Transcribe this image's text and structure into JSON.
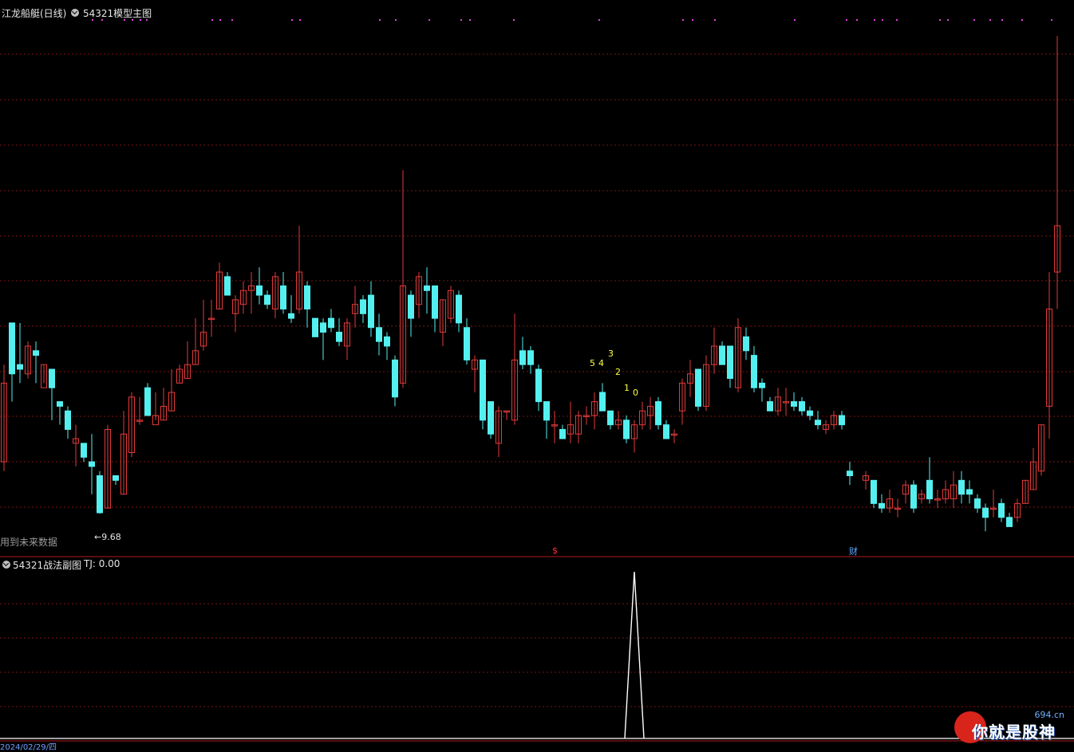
{
  "header": {
    "title": "江龙船艇(日线)",
    "model_name": "54321模型主图"
  },
  "sub_header": {
    "title": "54321战法副图",
    "tj_label": "TJ: 0.00"
  },
  "annotations": {
    "future_data": "用到未来数据",
    "low_label": "←9.68",
    "signal_s": "$",
    "signal_cai": "财",
    "countdown": [
      "5",
      "4",
      "3",
      "2",
      "1",
      "0"
    ],
    "date_label": "2024/02/29/四"
  },
  "watermark": {
    "site": "694.cn",
    "text": "你就是股神"
  },
  "colors": {
    "up": "#e23a3a",
    "down": "#54f0f0",
    "grid": "#7a1414",
    "signal_dot": "#e040e0",
    "countdown": "#ffff44",
    "tj_line": "#ffffff"
  },
  "chart_data": [
    {
      "type": "candlestick",
      "ylim": [
        9.2,
        20.0
      ],
      "series": [
        {
          "values": [
            [
              10.8,
              12.5,
              12.9,
              10.6
            ],
            [
              13.8,
              12.7,
              13.5,
              12.1
            ],
            [
              12.9,
              12.8,
              13.8,
              12.5
            ],
            [
              12.7,
              13.3,
              13.4,
              12.6
            ],
            [
              13.2,
              13.1,
              13.4,
              12.5
            ],
            [
              12.4,
              12.9,
              12.9,
              12.5
            ],
            [
              12.8,
              12.4,
              12.8,
              11.7
            ],
            [
              12.1,
              12.0,
              12.1,
              11.6
            ],
            [
              11.9,
              11.5,
              12.0,
              11.3
            ],
            [
              11.2,
              11.3,
              11.6,
              10.7
            ],
            [
              11.2,
              10.9,
              11.2,
              10.8
            ],
            [
              10.8,
              10.7,
              11.4,
              10.1
            ],
            [
              10.5,
              9.7,
              10.6,
              9.68
            ],
            [
              9.8,
              11.5,
              11.6,
              9.8
            ],
            [
              10.5,
              10.4,
              10.5,
              10.3
            ],
            [
              10.1,
              11.4,
              11.9,
              10.1
            ],
            [
              11.0,
              12.2,
              12.3,
              10.9
            ],
            [
              11.7,
              11.7,
              12.2,
              11.6
            ],
            [
              12.4,
              11.8,
              12.5,
              11.8
            ],
            [
              11.6,
              11.8,
              12.3,
              11.7
            ],
            [
              11.7,
              12.0,
              12.4,
              11.7
            ],
            [
              11.9,
              12.3,
              12.8,
              11.9
            ],
            [
              12.5,
              12.8,
              12.9,
              12.5
            ],
            [
              12.6,
              12.9,
              13.4,
              12.6
            ],
            [
              12.9,
              13.2,
              13.9,
              12.9
            ],
            [
              13.3,
              13.6,
              14.3,
              13.2
            ],
            [
              13.9,
              13.9,
              14.3,
              13.5
            ],
            [
              14.1,
              14.9,
              15.1,
              14.1
            ],
            [
              14.8,
              14.4,
              14.9,
              14.4
            ],
            [
              14.0,
              14.3,
              14.4,
              13.6
            ],
            [
              14.2,
              14.5,
              14.7,
              14.0
            ],
            [
              14.5,
              14.6,
              14.9,
              14.0
            ],
            [
              14.6,
              14.4,
              15.0,
              14.2
            ],
            [
              14.4,
              14.2,
              14.5,
              14.1
            ],
            [
              14.1,
              14.8,
              14.9,
              13.9
            ],
            [
              14.6,
              14.1,
              14.9,
              14.0
            ],
            [
              14.0,
              13.9,
              14.4,
              13.8
            ],
            [
              14.1,
              14.9,
              15.9,
              14.0
            ],
            [
              14.6,
              14.1,
              14.7,
              13.7
            ],
            [
              13.9,
              13.5,
              13.9,
              13.5
            ],
            [
              13.8,
              13.6,
              13.9,
              13.0
            ],
            [
              13.9,
              13.7,
              14.1,
              13.6
            ],
            [
              13.6,
              13.4,
              13.9,
              13.3
            ],
            [
              13.3,
              13.8,
              13.9,
              13.0
            ],
            [
              14.0,
              14.2,
              14.6,
              13.7
            ],
            [
              14.3,
              14.0,
              14.4,
              13.8
            ],
            [
              14.4,
              13.7,
              14.7,
              13.5
            ],
            [
              13.7,
              13.4,
              14.0,
              13.1
            ],
            [
              13.5,
              13.3,
              13.6,
              13.0
            ],
            [
              13.0,
              12.2,
              13.1,
              12.0
            ],
            [
              12.5,
              14.6,
              17.1,
              12.4
            ],
            [
              14.4,
              13.9,
              14.5,
              13.5
            ],
            [
              14.2,
              14.8,
              14.9,
              13.9
            ],
            [
              14.6,
              14.5,
              15.0,
              14.0
            ],
            [
              14.6,
              13.9,
              14.5,
              13.6
            ],
            [
              13.6,
              14.3,
              14.3,
              13.3
            ],
            [
              13.9,
              14.5,
              14.6,
              13.8
            ],
            [
              14.4,
              13.8,
              14.5,
              13.6
            ],
            [
              13.7,
              13.0,
              13.9,
              12.9
            ],
            [
              12.8,
              13.0,
              13.1,
              12.3
            ],
            [
              13.0,
              11.7,
              13.0,
              11.5
            ],
            [
              12.1,
              11.4,
              12.1,
              11.3
            ],
            [
              11.2,
              11.9,
              12.0,
              10.9
            ],
            [
              11.9,
              11.9,
              11.9,
              11.7
            ],
            [
              11.7,
              13.0,
              14.0,
              11.6
            ],
            [
              13.2,
              12.9,
              13.5,
              12.8
            ],
            [
              13.2,
              12.9,
              13.3,
              12.7
            ],
            [
              12.8,
              12.1,
              12.9,
              11.9
            ],
            [
              12.1,
              11.7,
              12.1,
              11.3
            ],
            [
              11.6,
              11.6,
              11.9,
              11.2
            ],
            [
              11.5,
              11.3,
              11.6,
              11.3
            ],
            [
              11.4,
              11.6,
              12.1,
              11.2
            ],
            [
              11.4,
              11.8,
              11.9,
              11.2
            ],
            [
              11.8,
              11.8,
              12.0,
              11.6
            ],
            [
              11.8,
              12.1,
              12.3,
              11.5
            ],
            [
              12.3,
              11.9,
              12.5,
              11.9
            ],
            [
              11.9,
              11.6,
              11.9,
              11.5
            ],
            [
              11.6,
              11.7,
              11.9,
              11.5
            ],
            [
              11.7,
              11.3,
              11.8,
              11.2
            ],
            [
              11.3,
              11.6,
              11.7,
              11.0
            ],
            [
              11.6,
              11.9,
              12.1,
              11.5
            ],
            [
              11.8,
              12.0,
              12.2,
              11.5
            ],
            [
              12.1,
              11.6,
              12.2,
              11.5
            ],
            [
              11.6,
              11.3,
              11.7,
              11.3
            ],
            [
              11.4,
              11.4,
              11.5,
              11.2
            ],
            [
              11.9,
              12.5,
              12.6,
              11.6
            ],
            [
              12.5,
              12.7,
              13.0,
              12.2
            ],
            [
              12.8,
              12.0,
              12.8,
              11.9
            ],
            [
              12.0,
              12.9,
              13.1,
              11.9
            ],
            [
              12.9,
              13.3,
              13.7,
              12.7
            ],
            [
              13.3,
              12.9,
              13.4,
              12.9
            ],
            [
              13.3,
              12.6,
              13.3,
              12.4
            ],
            [
              12.4,
              13.7,
              13.9,
              12.3
            ],
            [
              13.5,
              13.2,
              13.7,
              13.0
            ],
            [
              13.1,
              12.4,
              13.3,
              12.3
            ],
            [
              12.5,
              12.4,
              12.6,
              12.1
            ],
            [
              12.1,
              11.9,
              12.2,
              11.9
            ],
            [
              11.9,
              12.2,
              12.4,
              11.8
            ],
            [
              12.1,
              12.1,
              12.4,
              11.8
            ],
            [
              12.1,
              12.0,
              12.3,
              11.9
            ],
            [
              12.1,
              11.9,
              12.2,
              11.8
            ],
            [
              11.9,
              11.8,
              12.0,
              11.7
            ],
            [
              11.7,
              11.6,
              11.9,
              11.5
            ],
            [
              11.5,
              11.6,
              11.7,
              11.4
            ],
            [
              11.6,
              11.8,
              11.9,
              11.5
            ],
            [
              11.8,
              11.6,
              11.9,
              11.5
            ],
            [
              10.6,
              10.5,
              10.8,
              10.3
            ],
            [
              10.4,
              10.5,
              10.6,
              10.2
            ],
            [
              10.4,
              9.9,
              10.4,
              9.8
            ],
            [
              9.9,
              9.8,
              10.1,
              9.7
            ],
            [
              9.8,
              10.0,
              10.2,
              9.7
            ],
            [
              9.8,
              9.8,
              10.0,
              9.6
            ],
            [
              10.1,
              10.3,
              10.4,
              9.9
            ],
            [
              10.3,
              9.8,
              10.4,
              9.7
            ],
            [
              10.0,
              10.1,
              10.2,
              9.9
            ],
            [
              10.4,
              10.0,
              10.9,
              9.9
            ],
            [
              10.0,
              10.0,
              10.2,
              9.8
            ],
            [
              10.0,
              10.2,
              10.4,
              9.9
            ],
            [
              10.0,
              10.3,
              10.6,
              9.8
            ],
            [
              10.4,
              10.1,
              10.6,
              9.9
            ],
            [
              10.2,
              10.1,
              10.4,
              9.9
            ],
            [
              10.0,
              9.8,
              10.1,
              9.7
            ],
            [
              9.8,
              9.6,
              9.9,
              9.3
            ],
            [
              9.8,
              9.8,
              10.2,
              9.6
            ],
            [
              9.9,
              9.6,
              10.0,
              9.5
            ],
            [
              9.6,
              9.4,
              9.7,
              9.4
            ],
            [
              9.6,
              9.9,
              10.0,
              9.5
            ],
            [
              9.9,
              10.4,
              10.4,
              9.9
            ],
            [
              10.2,
              10.8,
              11.1,
              10.2
            ],
            [
              10.6,
              11.6,
              11.6,
              10.5
            ],
            [
              12.0,
              14.1,
              14.9,
              11.3
            ],
            [
              14.9,
              15.9,
              20.0,
              14.1
            ]
          ]
        }
      ]
    },
    {
      "type": "line",
      "ylim": [
        0,
        1
      ],
      "series": [
        {
          "name": "TJ",
          "values": [
            0,
            0,
            0,
            0,
            0,
            0,
            0,
            0,
            0,
            0,
            0,
            0,
            0,
            0,
            0,
            0,
            0,
            0,
            0,
            0,
            0,
            0,
            0,
            0,
            0,
            0,
            0,
            0,
            0,
            0,
            0,
            0,
            0,
            0,
            0,
            0,
            0,
            0,
            0,
            0,
            0,
            0,
            0,
            0,
            0,
            0,
            0,
            0,
            0,
            0,
            0,
            0,
            0,
            0,
            0,
            0,
            0,
            0,
            0,
            0,
            0,
            0,
            0,
            0,
            0,
            0,
            0,
            0,
            0,
            0,
            0,
            0,
            0,
            0,
            0,
            0,
            0,
            0,
            0,
            0,
            0,
            0,
            0,
            0,
            0,
            0,
            0,
            0,
            0,
            0,
            0,
            0,
            0,
            0,
            0,
            0,
            0,
            0,
            0,
            0,
            0,
            0,
            0,
            0,
            0,
            0,
            0,
            0,
            0,
            0,
            0,
            0,
            0,
            0,
            0,
            0,
            0,
            0,
            0,
            0,
            0,
            0,
            0,
            0,
            0,
            0,
            0,
            0,
            0,
            0,
            0,
            0,
            0,
            0,
            0,
            0,
            0,
            0
          ]
        }
      ]
    }
  ]
}
